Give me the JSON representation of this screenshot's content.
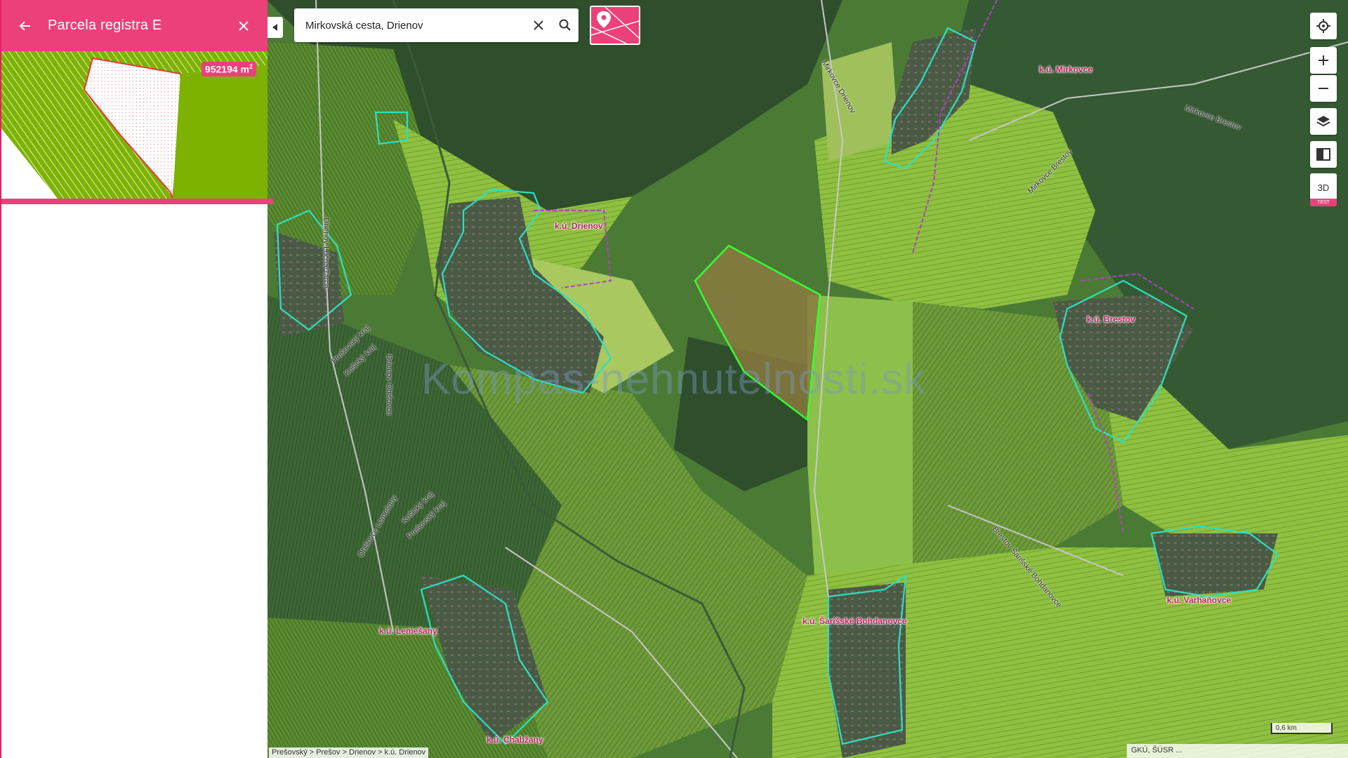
{
  "panel": {
    "title": "Parcela registra E",
    "area_value": "952194 m",
    "area_unit_sup": "2"
  },
  "search": {
    "value": "Mirkovská cesta, Drienov"
  },
  "controls": {
    "three_d_label": "3D",
    "test_label": "TEST"
  },
  "map": {
    "watermark": "Kompas-nehnutelnosti.sk",
    "cadastral_labels": [
      "k.ú. Mirkovce",
      "k.ú. Drienov",
      "k.ú. Brestov",
      "k.ú. Šarišské Bohdanovce",
      "k.ú. Varhaňovce",
      "k.ú. Lemešany",
      "k.ú. Chabžany"
    ],
    "road_labels": [
      "Mirkovce Drienov",
      "Mirkovce Brestov",
      "Mirkovce Brestov",
      "Drienov Lúčna/Tarce",
      "Prešovský kraj",
      "Košický kraj",
      "Drienov Obišovce",
      "Košický kraj",
      "Prešovský kraj",
      "Obišovce Lemešany",
      "Brestov Šarišské Bohdanovce"
    ],
    "colors": {
      "cadastral_boundary": "#2ee0c0",
      "region_boundary": "#b040c0",
      "parcel_outline": "#33ff33",
      "accent": "#ec407a"
    }
  },
  "footer": {
    "breadcrumb": "Prešovský > Prešov > Drienov > k.ú. Drienov",
    "attribution": "GKÚ, ŠÚSR ...",
    "scale": "0,6 km"
  }
}
